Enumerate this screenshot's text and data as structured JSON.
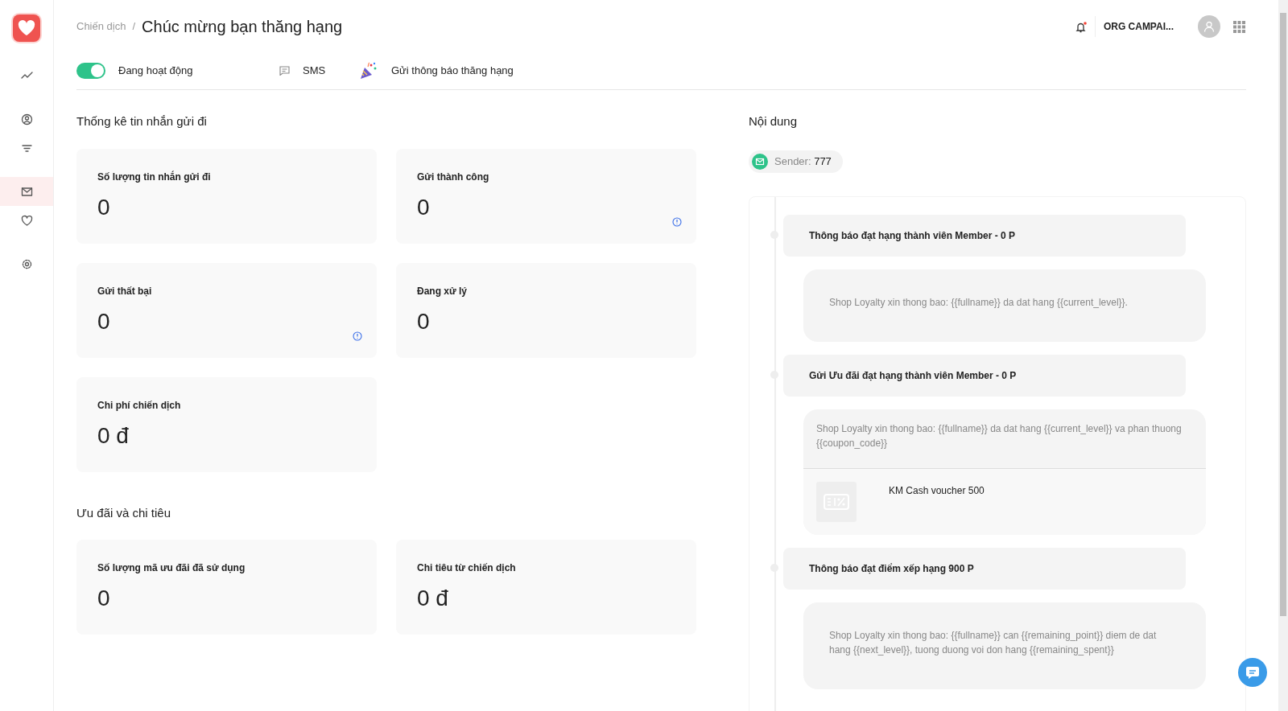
{
  "sidebar": {
    "items": [
      {
        "kind": "chart",
        "selected": false
      },
      {
        "kind": "user",
        "selected": false
      },
      {
        "kind": "filter",
        "selected": false
      },
      {
        "kind": "mail",
        "selected": true
      },
      {
        "kind": "heart",
        "selected": false
      },
      {
        "kind": "settings",
        "selected": false
      }
    ]
  },
  "header": {
    "breadcrumb": "Chiến dịch",
    "separator": "/",
    "title": "Chúc mừng bạn thăng hạng",
    "notifications": {
      "unread": true
    },
    "org": "ORG CAMPAI..."
  },
  "status_bar": {
    "toggle": {
      "on": true,
      "label": "Đang hoạt động"
    },
    "channel": "SMS",
    "type": "Gửi thông báo thăng hạng"
  },
  "sections": [
    {
      "title": "Thống kê tin nhắn gửi đi",
      "cards": [
        {
          "label": "Số lượng tin nhắn gửi đi",
          "value": "0",
          "info": false
        },
        {
          "label": "Gửi thành công",
          "value": "0",
          "info": true
        },
        {
          "label": "Gửi thất bại",
          "value": "0",
          "info": true
        },
        {
          "label": "Đang xử lý",
          "value": "0",
          "info": false
        },
        {
          "label": "Chi phí chiến dịch",
          "value": "0 đ",
          "info": false
        }
      ]
    },
    {
      "title": "Ưu đãi và chi tiêu",
      "cards": [
        {
          "label": "Số lượng mã ưu đãi đã sử dụng",
          "value": "0",
          "info": false
        },
        {
          "label": "Chi tiêu từ chiến dịch",
          "value": "0 đ",
          "info": false
        }
      ]
    }
  ],
  "content": {
    "title": "Nội dung",
    "sender": {
      "label": "Sender:",
      "value": "777"
    },
    "messages": [
      {
        "title": "Thông báo đạt hạng thành viên Member - 0 P",
        "body": "Shop Loyalty xin thong bao: {{fullname}} da dat hang {{current_level}}."
      },
      {
        "title": "Gửi Ưu đãi đạt hạng thành viên Member - 0 P",
        "body": "Shop Loyalty xin thong bao: {{fullname}} da dat hang {{current_level}} va phan thuong {{coupon_code}}",
        "voucher": {
          "name": "KM Cash voucher 500"
        }
      },
      {
        "title": "Thông báo đạt điểm xếp hạng 900 P",
        "body": "Shop Loyalty xin thong bao: {{fullname}} can {{remaining_point}} diem de dat hang {{next_level}}, tuong duong voi don hang {{remaining_spent}}"
      }
    ]
  }
}
